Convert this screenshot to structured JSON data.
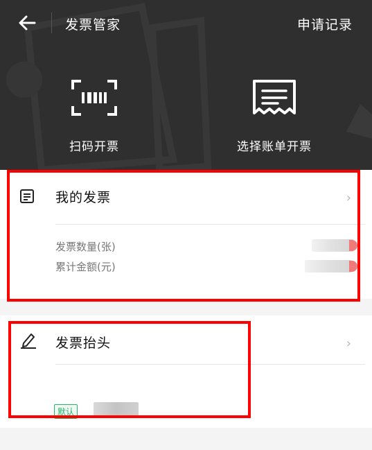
{
  "header": {
    "title": "发票管家",
    "records_label": "申请记录"
  },
  "actions": {
    "scan_label": "扫码开票",
    "select_bill_label": "选择账单开票"
  },
  "my_invoices": {
    "label": "我的发票",
    "count_label": "发票数量(张)",
    "amount_label": "累计金额(元)"
  },
  "invoice_title": {
    "label": "发票抬头",
    "default_tag": "默认"
  },
  "colors": {
    "header_bg": "#2f2f2f",
    "highlight_box": "#ff0000",
    "default_tag": "#27b36a"
  }
}
